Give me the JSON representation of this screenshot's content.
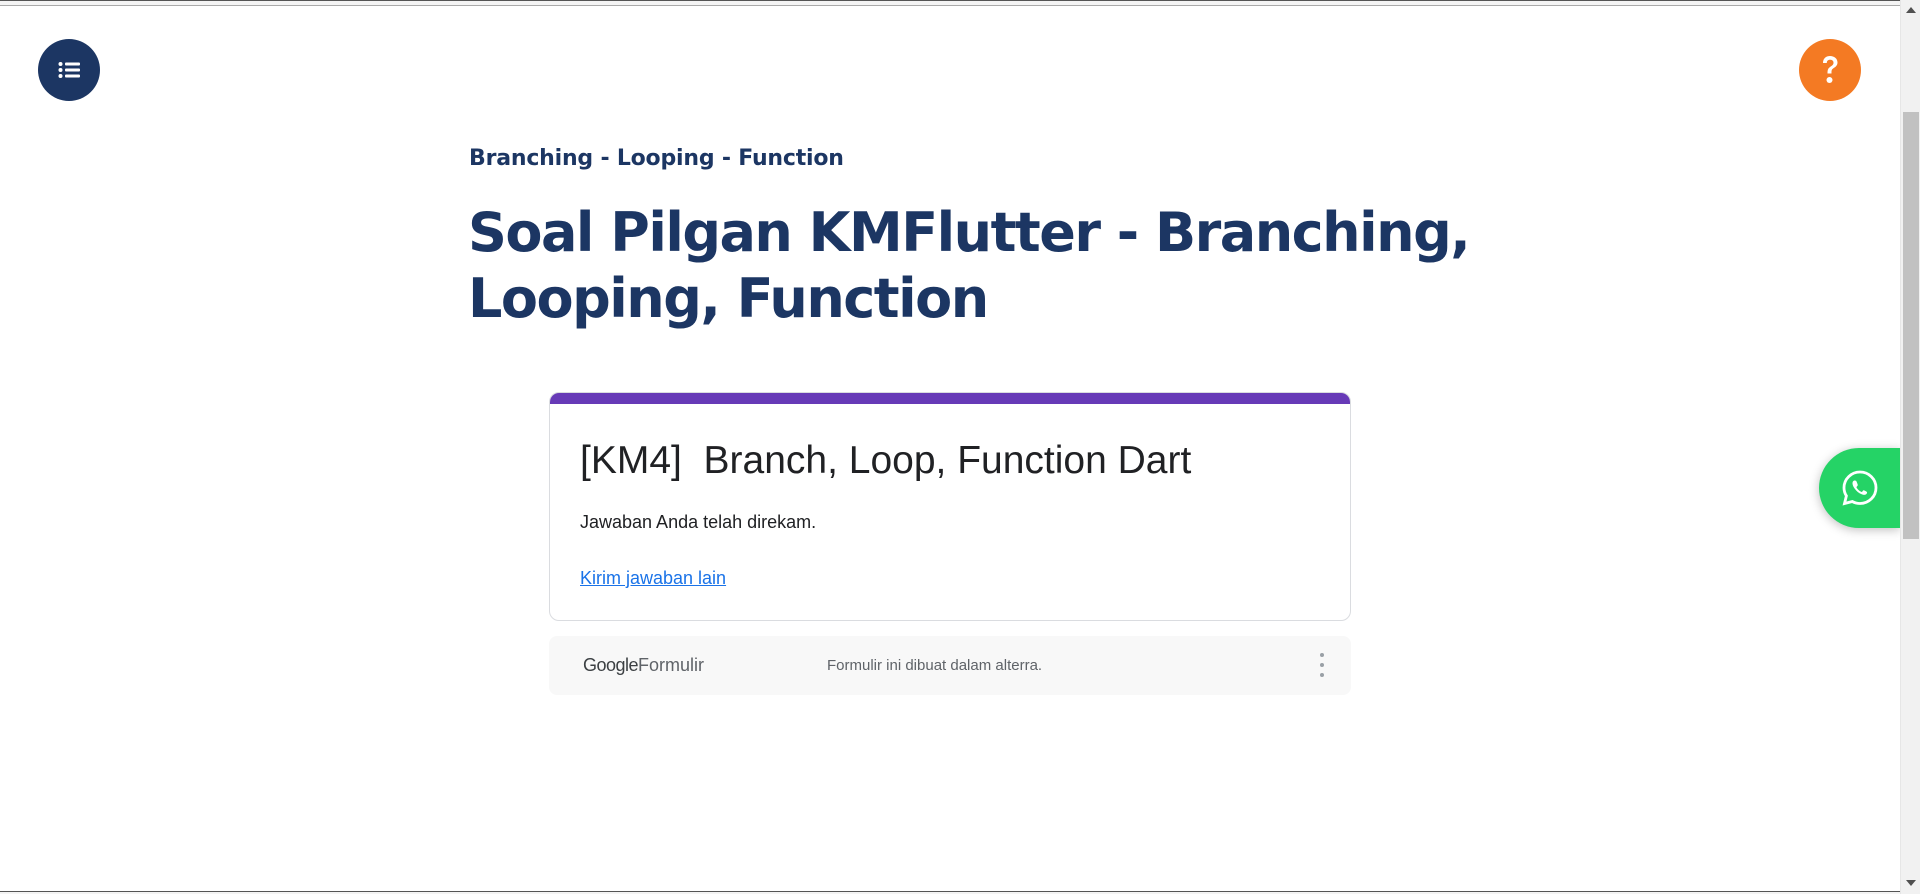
{
  "nav": {
    "menu_icon": "list-icon",
    "help_icon": "question-mark-icon",
    "whatsapp_icon": "whatsapp-icon"
  },
  "header": {
    "breadcrumb": "Branching - Looping - Function",
    "title": "Soal Pilgan KMFlutter - Branching, Looping, Function"
  },
  "form": {
    "title": "[KM4]  Branch, Loop, Function Dart",
    "message": "Jawaban Anda telah direkam.",
    "link": "Kirim jawaban lain"
  },
  "footer": {
    "logo_google": "Google",
    "logo_product": "Formulir",
    "note": "Formulir ini dibuat dalam alterra.",
    "more_icon": "more-vert-icon"
  },
  "colors": {
    "navy": "#1c3663",
    "orange": "#f47a23",
    "form_accent": "#673ab7",
    "link": "#1a73e8",
    "whatsapp": "#25d366"
  }
}
